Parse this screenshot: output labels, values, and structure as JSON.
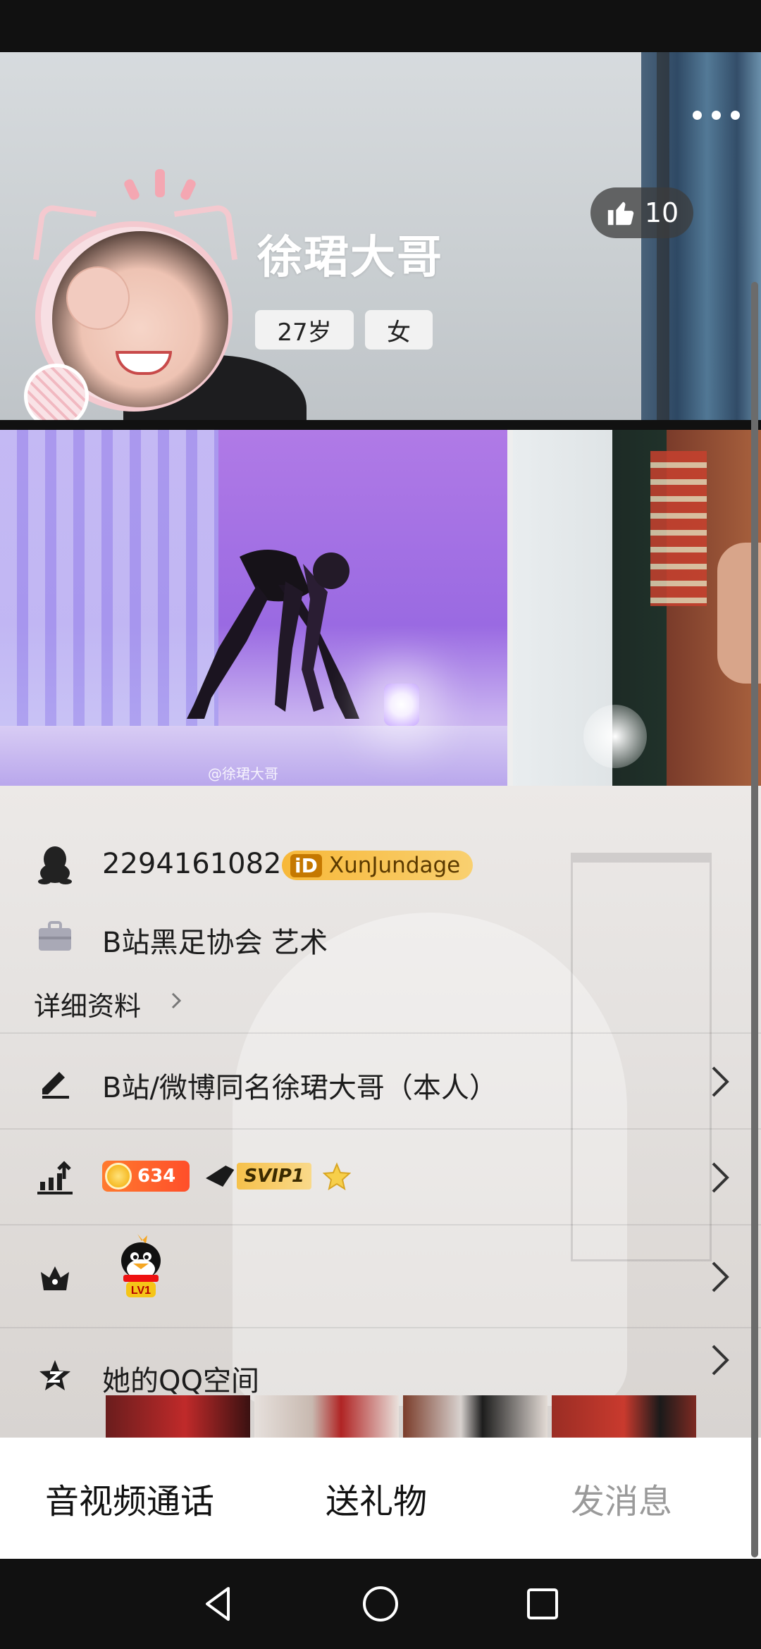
{
  "profile": {
    "name": "徐珺大哥",
    "age": "27岁",
    "gender": "女",
    "likes": "10"
  },
  "photos": {
    "watermark": "@徐珺大哥"
  },
  "info": {
    "qq_number": "2294161082",
    "id_badge": "XunJundage",
    "id_mark": "iD",
    "work": "B站黑足协会 艺术",
    "detail_link": "详细资料"
  },
  "signature": {
    "text": "B站/微博同名徐珺大哥（本人）"
  },
  "level": {
    "coins": "634",
    "svip": "SVIP1"
  },
  "pet": {
    "badge": "LV1"
  },
  "space": {
    "title": "她的QQ空间"
  },
  "actions": {
    "call": "音视频通话",
    "gift": "送礼物",
    "message": "发消息"
  },
  "icons": {
    "more": "more-dots-icon",
    "like": "thumbs-up-icon",
    "qq": "qq-penguin-icon",
    "work": "briefcase-icon",
    "signature": "pen-icon",
    "level": "growth-chart-icon",
    "pet": "crown-icon",
    "space": "star-z-icon"
  },
  "colors": {
    "id_badge": "#f7b839",
    "coins": "#ff5a2a",
    "action_disabled": "#9a9a9a"
  }
}
